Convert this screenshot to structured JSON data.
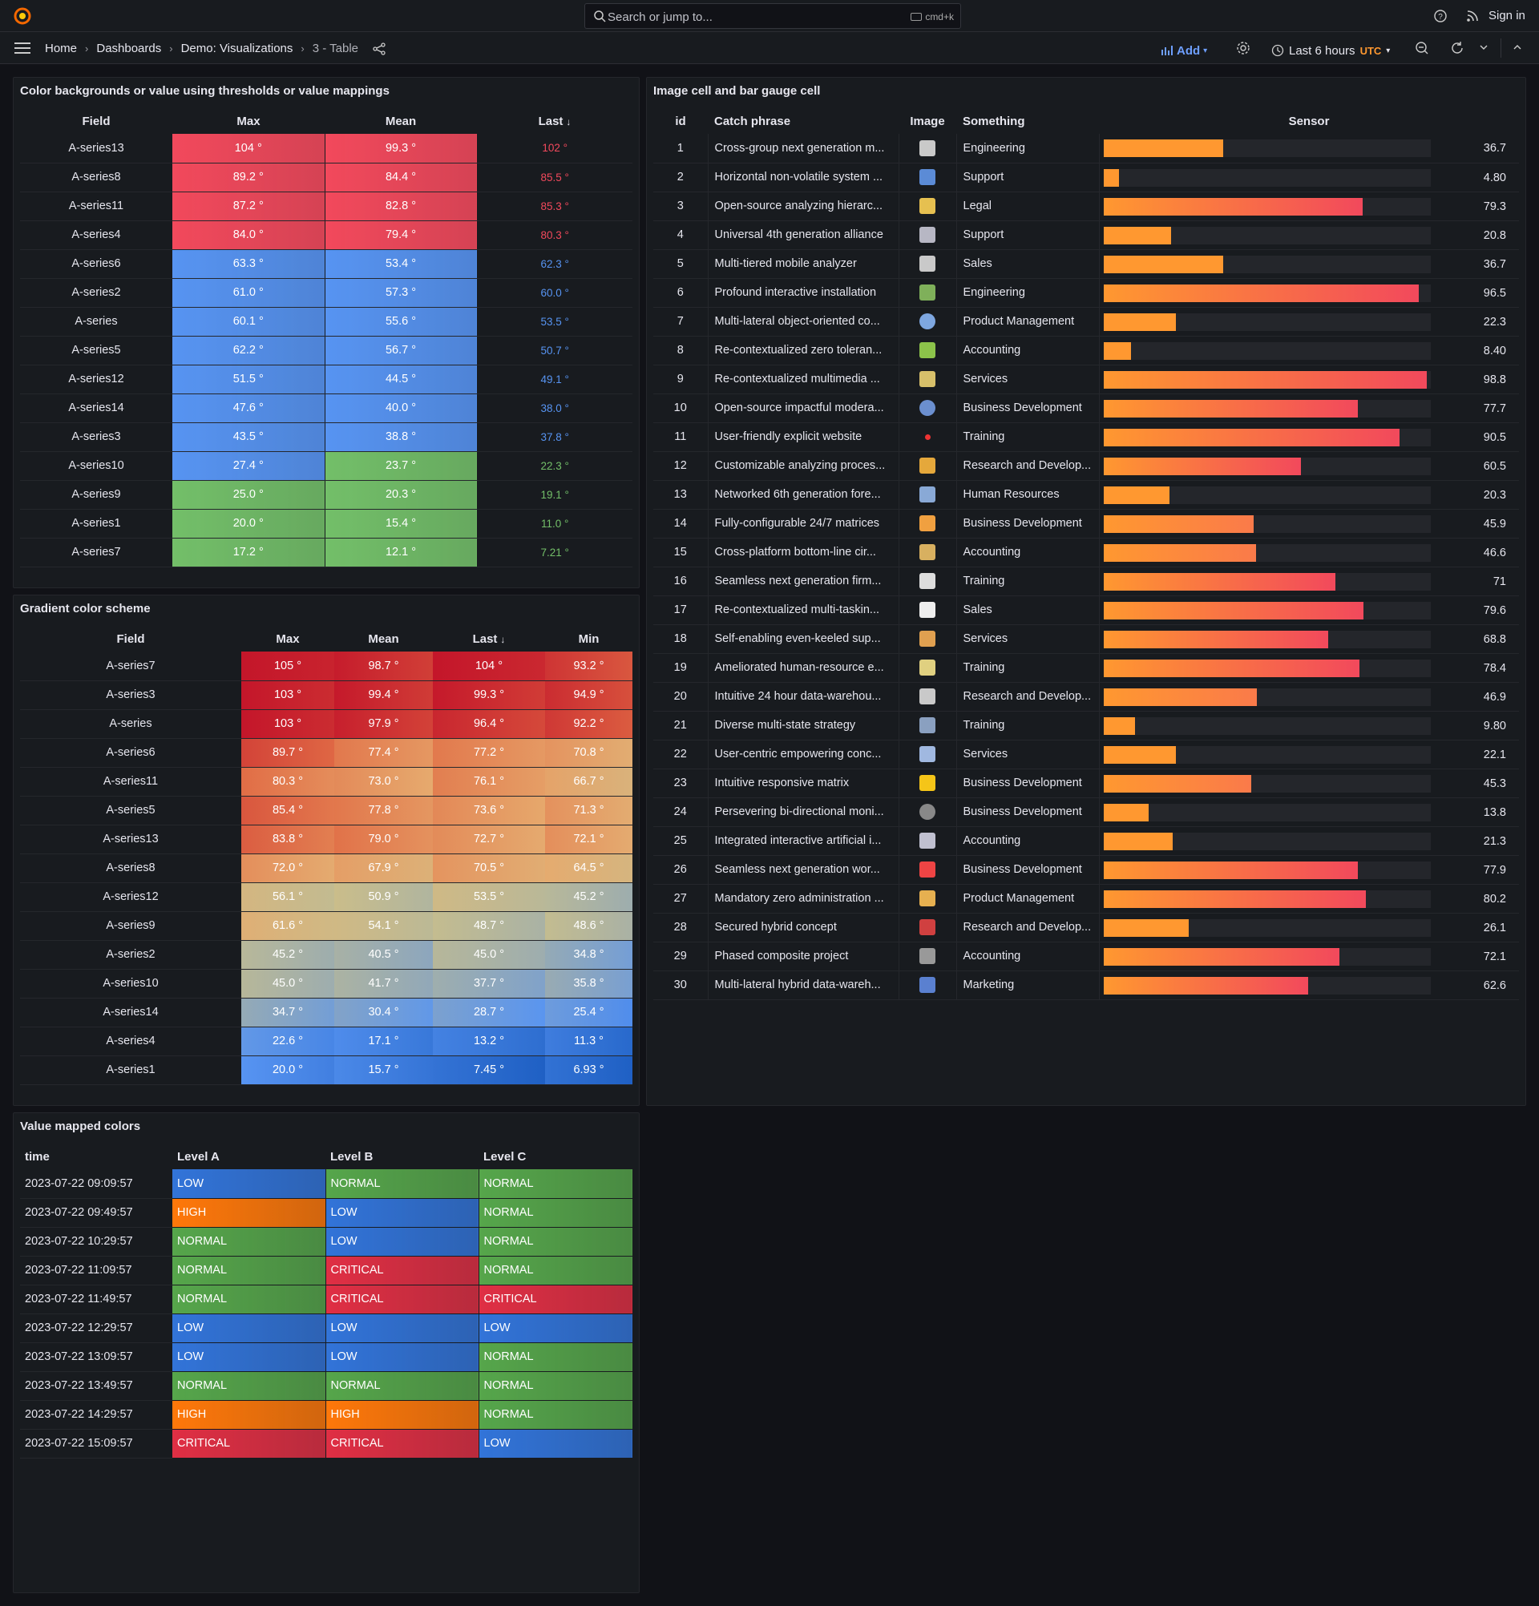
{
  "topbar": {
    "search_placeholder": "Search or jump to...",
    "search_shortcut": "cmd+k",
    "signin": "Sign in"
  },
  "breadcrumb": {
    "home": "Home",
    "dashboards": "Dashboards",
    "folder": "Demo: Visualizations",
    "current": "3 - Table"
  },
  "toolbar": {
    "add": "Add",
    "time_range": "Last 6 hours",
    "timezone": "UTC"
  },
  "panel1": {
    "title": "Color backgrounds or value using thresholds or value mappings",
    "headers": [
      "Field",
      "Max",
      "Mean",
      "Last"
    ],
    "rows": [
      [
        "A-series13",
        "104 °",
        "99.3 °",
        "102 °",
        "red"
      ],
      [
        "A-series8",
        "89.2 °",
        "84.4 °",
        "85.5 °",
        "red"
      ],
      [
        "A-series11",
        "87.2 °",
        "82.8 °",
        "85.3 °",
        "red"
      ],
      [
        "A-series4",
        "84.0 °",
        "79.4 °",
        "80.3 °",
        "red"
      ],
      [
        "A-series6",
        "63.3 °",
        "53.4 °",
        "62.3 °",
        "blue"
      ],
      [
        "A-series2",
        "61.0 °",
        "57.3 °",
        "60.0 °",
        "blue"
      ],
      [
        "A-series",
        "60.1 °",
        "55.6 °",
        "53.5 °",
        "blue"
      ],
      [
        "A-series5",
        "62.2 °",
        "56.7 °",
        "50.7 °",
        "blue"
      ],
      [
        "A-series12",
        "51.5 °",
        "44.5 °",
        "49.1 °",
        "blue"
      ],
      [
        "A-series14",
        "47.6 °",
        "40.0 °",
        "38.0 °",
        "blue"
      ],
      [
        "A-series3",
        "43.5 °",
        "38.8 °",
        "37.8 °",
        "blue"
      ],
      [
        "A-series10",
        "27.4 °",
        "23.7 °",
        "22.3 °",
        "bg"
      ],
      [
        "A-series9",
        "25.0 °",
        "20.3 °",
        "19.1 °",
        "green"
      ],
      [
        "A-series1",
        "20.0 °",
        "15.4 °",
        "11.0 °",
        "green"
      ],
      [
        "A-series7",
        "17.2 °",
        "12.1 °",
        "7.21 °",
        "green"
      ]
    ]
  },
  "panel2": {
    "title": "Gradient color scheme",
    "headers": [
      "Field",
      "Max",
      "Mean",
      "Last",
      "Min"
    ],
    "rows": [
      [
        "A-series7",
        "105 °",
        "98.7 °",
        "104 °",
        "93.2 °"
      ],
      [
        "A-series3",
        "103 °",
        "99.4 °",
        "99.3 °",
        "94.9 °"
      ],
      [
        "A-series",
        "103 °",
        "97.9 °",
        "96.4 °",
        "92.2 °"
      ],
      [
        "A-series6",
        "89.7 °",
        "77.4 °",
        "77.2 °",
        "70.8 °"
      ],
      [
        "A-series11",
        "80.3 °",
        "73.0 °",
        "76.1 °",
        "66.7 °"
      ],
      [
        "A-series5",
        "85.4 °",
        "77.8 °",
        "73.6 °",
        "71.3 °"
      ],
      [
        "A-series13",
        "83.8 °",
        "79.0 °",
        "72.7 °",
        "72.1 °"
      ],
      [
        "A-series8",
        "72.0 °",
        "67.9 °",
        "70.5 °",
        "64.5 °"
      ],
      [
        "A-series12",
        "56.1 °",
        "50.9 °",
        "53.5 °",
        "45.2 °"
      ],
      [
        "A-series9",
        "61.6 °",
        "54.1 °",
        "48.7 °",
        "48.6 °"
      ],
      [
        "A-series2",
        "45.2 °",
        "40.5 °",
        "45.0 °",
        "34.8 °"
      ],
      [
        "A-series10",
        "45.0 °",
        "41.7 °",
        "37.7 °",
        "35.8 °"
      ],
      [
        "A-series14",
        "34.7 °",
        "30.4 °",
        "28.7 °",
        "25.4 °"
      ],
      [
        "A-series4",
        "22.6 °",
        "17.1 °",
        "13.2 °",
        "11.3 °"
      ],
      [
        "A-series1",
        "20.0 °",
        "15.7 °",
        "7.45 °",
        "6.93 °"
      ]
    ]
  },
  "panel3": {
    "title": "Value mapped colors",
    "headers": [
      "time",
      "Level A",
      "Level B",
      "Level C"
    ],
    "rows": [
      [
        "2023-07-22 09:09:57",
        "LOW",
        "NORMAL",
        "NORMAL"
      ],
      [
        "2023-07-22 09:49:57",
        "HIGH",
        "LOW",
        "NORMAL"
      ],
      [
        "2023-07-22 10:29:57",
        "NORMAL",
        "LOW",
        "NORMAL"
      ],
      [
        "2023-07-22 11:09:57",
        "NORMAL",
        "CRITICAL",
        "NORMAL"
      ],
      [
        "2023-07-22 11:49:57",
        "NORMAL",
        "CRITICAL",
        "CRITICAL"
      ],
      [
        "2023-07-22 12:29:57",
        "LOW",
        "LOW",
        "LOW"
      ],
      [
        "2023-07-22 13:09:57",
        "LOW",
        "LOW",
        "NORMAL"
      ],
      [
        "2023-07-22 13:49:57",
        "NORMAL",
        "NORMAL",
        "NORMAL"
      ],
      [
        "2023-07-22 14:29:57",
        "HIGH",
        "HIGH",
        "NORMAL"
      ],
      [
        "2023-07-22 15:09:57",
        "CRITICAL",
        "CRITICAL",
        "LOW"
      ]
    ]
  },
  "panel4": {
    "title": "Image cell and bar gauge cell",
    "headers": [
      "id",
      "Catch phrase",
      "Image",
      "Something",
      "Sensor"
    ],
    "sensor_max": 100,
    "rows": [
      [
        "1",
        "Cross-group next generation m...",
        "trophy-icon",
        "Engineering",
        36.7,
        "36.7"
      ],
      [
        "2",
        "Horizontal non-volatile system ...",
        "chart-icon",
        "Support",
        4.8,
        "4.80"
      ],
      [
        "3",
        "Open-source analyzing hierarc...",
        "storm-icon",
        "Legal",
        79.3,
        "79.3"
      ],
      [
        "4",
        "Universal 4th generation alliance",
        "printer-icon",
        "Support",
        20.8,
        "20.8"
      ],
      [
        "5",
        "Multi-tiered mobile analyzer",
        "cart-icon",
        "Sales",
        36.7,
        "36.7"
      ],
      [
        "6",
        "Profound interactive installation",
        "picture-icon",
        "Engineering",
        96.5,
        "96.5"
      ],
      [
        "7",
        "Multi-lateral object-oriented co...",
        "cd-icon",
        "Product Management",
        22.3,
        "22.3"
      ],
      [
        "8",
        "Re-contextualized zero toleran...",
        "puzzle-icon",
        "Accounting",
        8.4,
        "8.40"
      ],
      [
        "9",
        "Re-contextualized multimedia ...",
        "map-icon",
        "Services",
        98.8,
        "98.8"
      ],
      [
        "10",
        "Open-source impactful modera...",
        "eject-icon",
        "Business Development",
        77.7,
        "77.7"
      ],
      [
        "11",
        "User-friendly explicit website",
        "dot-icon",
        "Training",
        90.5,
        "90.5"
      ],
      [
        "12",
        "Customizable analyzing proces...",
        "shield-icon",
        "Research and Develop...",
        60.5,
        "60.5"
      ],
      [
        "13",
        "Networked 6th generation fore...",
        "add-doc-icon",
        "Human Resources",
        20.3,
        "20.3"
      ],
      [
        "14",
        "Fully-configurable 24/7 matrices",
        "user-icon",
        "Business Development",
        45.9,
        "45.9"
      ],
      [
        "15",
        "Cross-platform bottom-line cir...",
        "package-icon",
        "Accounting",
        46.6,
        "46.6"
      ],
      [
        "16",
        "Seamless next generation firm...",
        "document-icon",
        "Training",
        71,
        "71"
      ],
      [
        "17",
        "Re-contextualized multi-taskin...",
        "alert-doc-icon",
        "Sales",
        79.6,
        "79.6"
      ],
      [
        "18",
        "Self-enabling even-keeled sup...",
        "users-icon",
        "Services",
        68.8,
        "68.8"
      ],
      [
        "19",
        "Ameliorated human-resource e...",
        "note-icon",
        "Training",
        78.4,
        "78.4"
      ],
      [
        "20",
        "Intuitive 24 hour data-warehou...",
        "cart-icon",
        "Research and Develop...",
        46.9,
        "46.9"
      ],
      [
        "21",
        "Diverse multi-state strategy",
        "robot-icon",
        "Training",
        9.8,
        "9.80"
      ],
      [
        "22",
        "User-centric empowering conc...",
        "copy-icon",
        "Services",
        22.1,
        "22.1"
      ],
      [
        "23",
        "Intuitive responsive matrix",
        "lightning-icon",
        "Business Development",
        45.3,
        "45.3"
      ],
      [
        "24",
        "Persevering bi-directional moni...",
        "ball-icon",
        "Business Development",
        13.8,
        "13.8"
      ],
      [
        "25",
        "Integrated interactive artificial i...",
        "feed-icon",
        "Accounting",
        21.3,
        "21.3"
      ],
      [
        "26",
        "Seamless next generation wor...",
        "star-icon",
        "Business Development",
        77.9,
        "77.9"
      ],
      [
        "27",
        "Mandatory zero administration ...",
        "folder-icon",
        "Product Management",
        80.2,
        "80.2"
      ],
      [
        "28",
        "Secured hybrid concept",
        "graph-icon",
        "Research and Develop...",
        26.1,
        "26.1"
      ],
      [
        "29",
        "Phased composite project",
        "text-icon",
        "Accounting",
        72.1,
        "72.1"
      ],
      [
        "30",
        "Multi-lateral hybrid data-wareh...",
        "bar-chart-icon",
        "Marketing",
        62.6,
        "62.6"
      ]
    ]
  },
  "colors": {
    "red": "#f2495c",
    "blue": "#5794f2",
    "green": "#73bf69",
    "orange": "#ff9830",
    "low": "#3274d9",
    "normal": "#56a64b",
    "high": "#ff780a",
    "critical": "#e02f44"
  }
}
